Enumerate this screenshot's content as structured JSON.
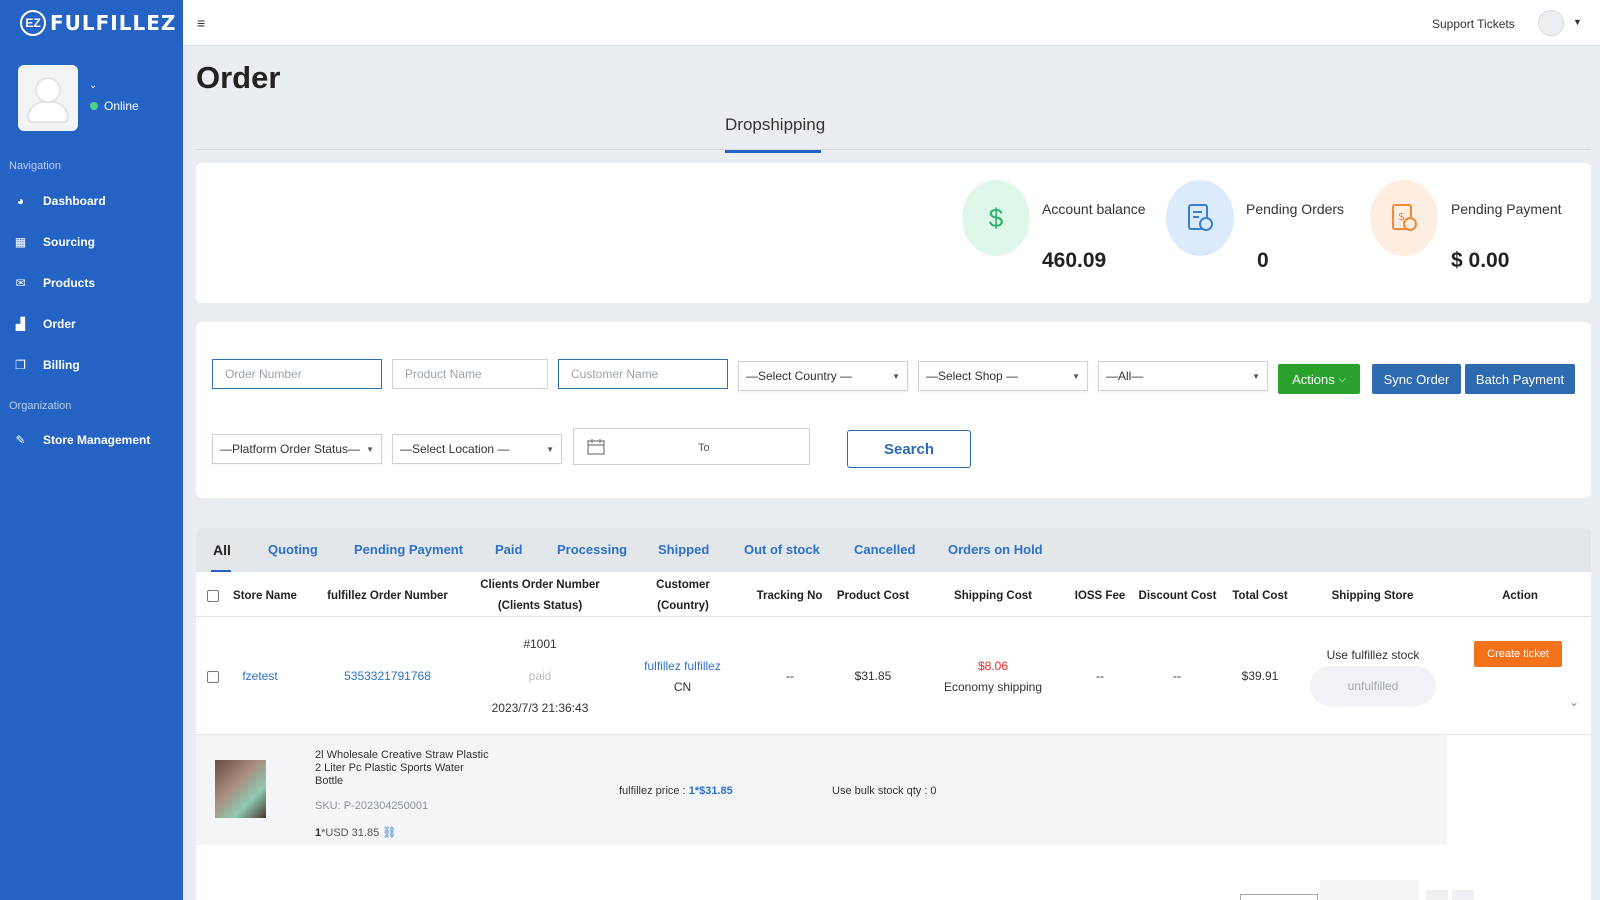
{
  "app": {
    "name": "FULFILLEZ",
    "logo_letter": "EZ"
  },
  "sidebar": {
    "status": "Online",
    "navigation_label": "Navigation",
    "organization_label": "Organization",
    "items": [
      {
        "label": "Dashboard",
        "icon": "dashboard-icon"
      },
      {
        "label": "Sourcing",
        "icon": "grid-icon"
      },
      {
        "label": "Products",
        "icon": "envelope-icon"
      },
      {
        "label": "Order",
        "icon": "bar-chart-icon"
      },
      {
        "label": "Billing",
        "icon": "copy-icon"
      },
      {
        "label": "Store Management",
        "icon": "edit-icon"
      }
    ]
  },
  "topbar": {
    "support": "Support Tickets"
  },
  "page": {
    "title": "Order",
    "tab": "Dropshipping"
  },
  "stats": {
    "balance_label": "Account balance",
    "balance_value": "460.09",
    "pending_orders_label": "Pending Orders",
    "pending_orders_value": "0",
    "pending_payment_label": "Pending Payment",
    "pending_payment_value": "$ 0.00",
    "colors": {
      "green": "#dff7ea",
      "blue": "#dcebfb",
      "orange": "#fdeee1"
    }
  },
  "filters": {
    "order_number": "Order Number",
    "product_name": "Product Name",
    "customer_name": "Customer Name",
    "country": "—Select Country —",
    "shop": "—Select Shop —",
    "all": "—All—",
    "actions": "Actions",
    "sync": "Sync Order",
    "batch": "Batch Payment",
    "platform_status": "—Platform Order Status—",
    "location": "—Select Location —",
    "date_to": "To",
    "search": "Search"
  },
  "order_tabs": [
    "All",
    "Quoting",
    "Pending Payment",
    "Paid",
    "Processing",
    "Shipped",
    "Out of stock",
    "Cancelled",
    "Orders on Hold"
  ],
  "table": {
    "headers": {
      "store": "Store Name",
      "order_no": "fulfillez Order Number",
      "client_order_1": "Clients Order Number",
      "client_order_2": "(Clients Status)",
      "customer_1": "Customer",
      "customer_2": "(Country)",
      "tracking": "Tracking No",
      "product_cost": "Product Cost",
      "shipping_cost": "Shipping Cost",
      "ioss": "IOSS Fee",
      "discount": "Discount Cost",
      "total": "Total Cost",
      "shipping_store": "Shipping Store",
      "action": "Action"
    },
    "row": {
      "store": "fzetest",
      "order_no": "5353321791768",
      "client_order": "#1001",
      "client_status": "paid",
      "client_date": "2023/7/3 21:36:43",
      "customer": "fulfillez fulfillez",
      "country": "CN",
      "tracking": "--",
      "product_cost": "$31.85",
      "shipping_cost": "$8.06",
      "shipping_method": "Economy shipping",
      "ioss": "--",
      "discount": "--",
      "total": "$39.91",
      "shipping_store": "Use fulfillez stock",
      "fulfillment": "unfulfilled",
      "action": "Create ticket"
    },
    "product": {
      "title_line1": "2l Wholesale Creative Straw Plastic",
      "title_line2": "2 Liter Pc Plastic Sports Water",
      "title_line3": "Bottle",
      "sku": "SKU: P-202304250001",
      "qty_price_prefix": "1",
      "qty_price": "*USD 31.85",
      "fulfillez_price_label": "fulfillez price :",
      "fulfillez_price_value": "1*$31.85",
      "bulk": "Use bulk stock qty : 0"
    }
  }
}
